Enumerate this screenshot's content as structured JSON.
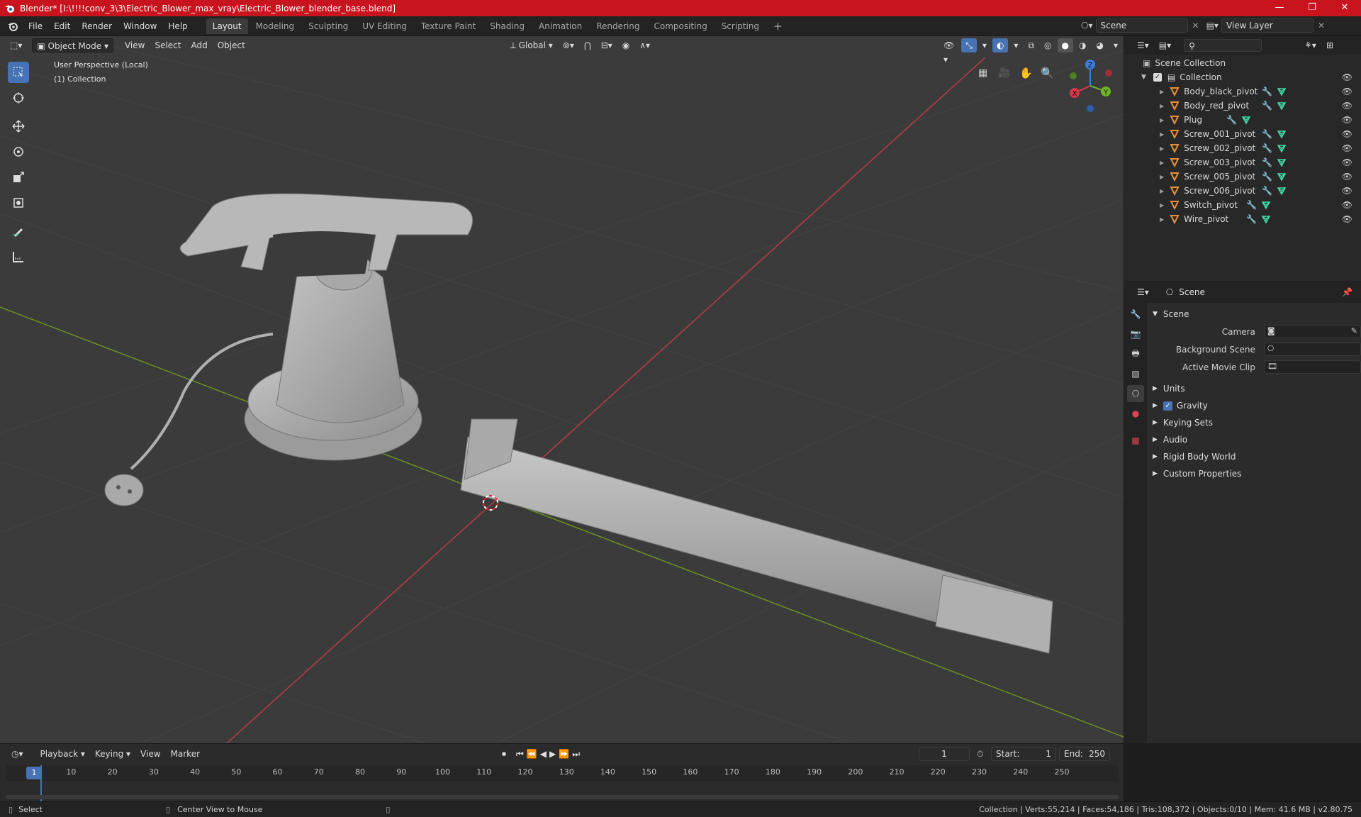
{
  "title": "Blender* [I:\\!!!!conv_3\\3\\Electric_Blower_max_vray\\Electric_Blower_blender_base.blend]",
  "menus": [
    "File",
    "Edit",
    "Render",
    "Window",
    "Help"
  ],
  "workspaces": [
    "Layout",
    "Modeling",
    "Sculpting",
    "UV Editing",
    "Texture Paint",
    "Shading",
    "Animation",
    "Rendering",
    "Compositing",
    "Scripting"
  ],
  "active_workspace": "Layout",
  "scene_name": "Scene",
  "view_layer": "View Layer",
  "viewport": {
    "mode": "Object Mode",
    "menus": [
      "View",
      "Select",
      "Add",
      "Object"
    ],
    "orientation": "Global",
    "overlay_line1": "User Perspective (Local)",
    "overlay_line2": "(1) Collection",
    "gizmo": {
      "x": "X",
      "y": "Y",
      "z": "Z"
    }
  },
  "outliner": {
    "root": "Scene Collection",
    "collection": "Collection",
    "items": [
      "Body_black_pivot",
      "Body_red_pivot",
      "Plug",
      "Screw_001_pivot",
      "Screw_002_pivot",
      "Screw_003_pivot",
      "Screw_005_pivot",
      "Screw_006_pivot",
      "Switch_pivot",
      "Wire_pivot"
    ]
  },
  "properties": {
    "header": "Scene",
    "section": "Scene",
    "fields": [
      {
        "label": "Camera"
      },
      {
        "label": "Background Scene"
      },
      {
        "label": "Active Movie Clip"
      }
    ],
    "panels": [
      "Units",
      "Gravity",
      "Keying Sets",
      "Audio",
      "Rigid Body World",
      "Custom Properties"
    ],
    "gravity_checked": true
  },
  "timeline": {
    "menus": [
      "Playback",
      "Keying",
      "View",
      "Marker"
    ],
    "current_frame": "1",
    "start_label": "Start:",
    "start": "1",
    "end_label": "End:",
    "end": "250",
    "ticks": [
      "1",
      "10",
      "20",
      "30",
      "40",
      "50",
      "60",
      "70",
      "80",
      "90",
      "100",
      "110",
      "120",
      "130",
      "140",
      "150",
      "160",
      "170",
      "180",
      "190",
      "200",
      "210",
      "220",
      "230",
      "240",
      "250"
    ]
  },
  "status": {
    "left_action": "Select",
    "mid_action": "Center View to Mouse",
    "stats": "Collection | Verts:55,214 | Faces:54,186 | Tris:108,372 | Objects:0/10 | Mem: 41.6 MB | v2.80.75"
  },
  "colors": {
    "accent": "#4772b3",
    "titlebar": "#c8141e",
    "x_axis": "#c0394a",
    "y_axis": "#7da02a",
    "object_icon": "#e5913a",
    "mesh_icon": "#3fd9a8",
    "mod_icon": "#6e9bd9"
  }
}
